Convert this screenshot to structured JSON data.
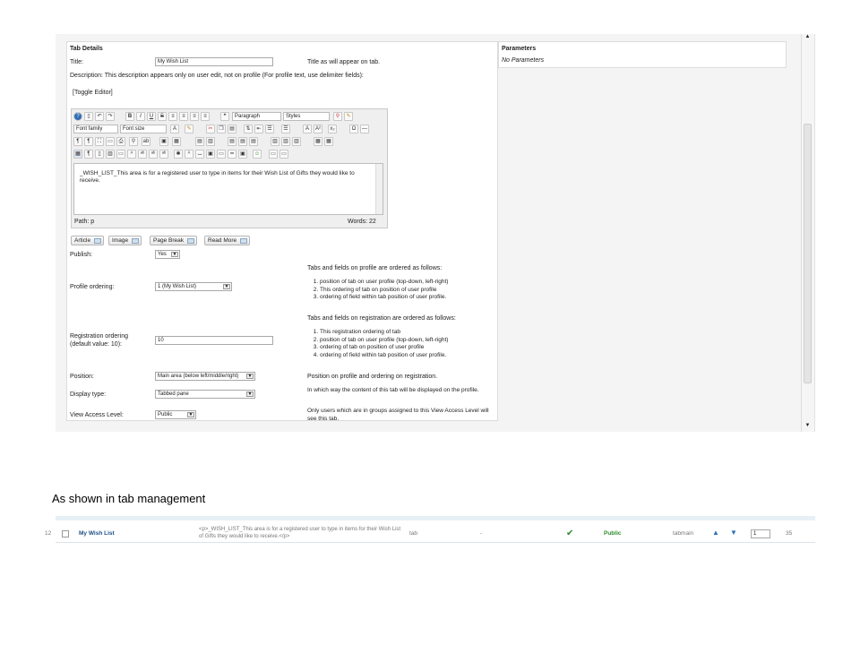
{
  "tab_details": {
    "header": "Tab Details",
    "title_label": "Title:",
    "title_value": "My Wish List",
    "title_help": "Title as will appear on tab.",
    "description_label": "Description: This description appears only on user edit, not on profile (For profile text, use delimiter fields):",
    "toggle_editor": "[Toggle Editor]"
  },
  "parameters": {
    "header": "Parameters",
    "none": "No Parameters"
  },
  "editor": {
    "format_select": "Paragraph",
    "styles_select": "Styles",
    "font_family": "Font family",
    "font_size": "Font size",
    "content": "_WISH_LIST_This area is for a registered user to type in items for their Wish List of Gifts they would like to receive.",
    "path": "Path:  p",
    "words": "Words: 22",
    "buttons": [
      "Article",
      "Image",
      "Page Break",
      "Read More"
    ],
    "icons": [
      "help-icon",
      "new-document-icon",
      "undo-icon",
      "redo-icon",
      "bold-icon",
      "italic-icon",
      "underline-icon",
      "strikethrough-icon",
      "align-left-icon",
      "align-center-icon",
      "align-right-icon",
      "align-justify-icon",
      "blockquote-icon",
      "link-icon",
      "cleanup-icon"
    ]
  },
  "form": {
    "publish_label": "Publish:",
    "publish_value": "Yes",
    "profile_ordering_label": "Profile ordering:",
    "profile_ordering_value": "1 (My Wish List)",
    "profile_ordering_help": "Tabs and fields on profile are ordered as follows:",
    "profile_ordering_list": [
      "position of tab on user profile (top-down, left-right)",
      "This ordering of tab on position of user profile",
      "ordering of field within tab position of user profile."
    ],
    "registration_ordering_label": "Registration ordering",
    "registration_ordering_label2": "(default value: 10):",
    "registration_ordering_value": "10",
    "registration_ordering_help": "Tabs and fields on registration are ordered as follows:",
    "registration_ordering_list": [
      "This registration ordering of tab",
      "position of tab on user profile (top-down, left-right)",
      "ordering of tab on position of user profile",
      "ordering of field within tab position of user profile."
    ],
    "position_label": "Position:",
    "position_value": "Main area (below left/middle/right)",
    "position_help": "Position on profile and ordering on registration.",
    "display_type_label": "Display type:",
    "display_type_value": "Tabbed pane",
    "display_type_help": "In which way the content of this tab will be displayed on the profile.",
    "view_access_label": "View Access Level:",
    "view_access_value": "Public",
    "view_access_help": "Only users which are in groups assigned to this View Access Level will see this tab."
  },
  "caption": "As shown in tab management",
  "tab_management": {
    "row": {
      "num": "12",
      "title": "My Wish List",
      "description": "<p>_WISH_LIST_This area is for a registered user to type in items for their Wish List of Gifts they would like to receive.</p>",
      "type": "tab",
      "plugin": "-",
      "access": "Public",
      "position": "tabmain",
      "order": "1",
      "id": "35"
    }
  },
  "colors": {
    "link": "#1a4f8a",
    "green": "#2e8b2e",
    "background": "#f4f4f4",
    "border": "#dcdcdc"
  }
}
